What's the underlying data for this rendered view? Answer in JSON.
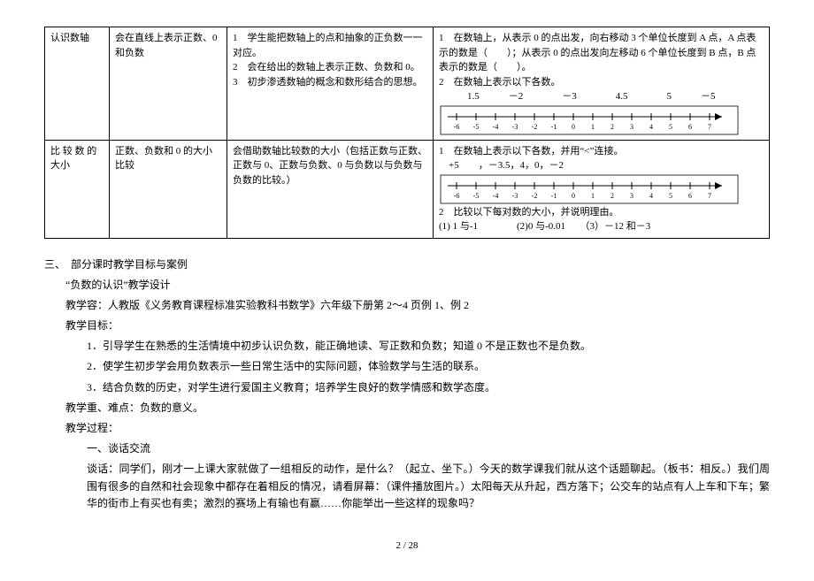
{
  "table": {
    "row1": {
      "c1": "认识数轴",
      "c2": "会在直线上表示正数、0 和负数",
      "c3_l1": "1　学生能把数轴上的点和抽象的正负数一一对应。",
      "c3_l2": "2　会在给出的数轴上表示正数、负数和 0。",
      "c3_l3": "3　初步渗透数轴的概念和数形结合的思想。",
      "c4_l1": "1　在数轴上，从表示 0 的点出发，向右移动 3 个单位长度到 A 点，A 点表示的数是（　　）；从表示 0 的点出发向左移动 6 个单位长度到 B 点，B 点表示的数是（　　）。",
      "c4_l2": "2　在数轴上表示以下各数。",
      "c4_nums": "　　1.5　　　－2　　　　－3　　　　4.5　　　　5　　　－5"
    },
    "row2": {
      "c1": "比 较 数 的大小",
      "c2": "正数、负数和 0 的大小比较",
      "c3": "会借助数轴比较数的大小（包括正数与正数、正数与 0、正数与负数、0 与负数以与负数与负数的比较。）",
      "c4_l1": "1　在数轴上表示以下各数，并用“<”连接。",
      "c4_nums": "　+5　　，－3.5，4，0，－2",
      "c4_l2": "2　比较以下每对数的大小，并说明理由。",
      "c4_l3": "(1) 1 与-1　　　　(2)0 与-0.01　　（3）－12 和－3"
    }
  },
  "section3": {
    "heading": "三、　部分课时教学目标与案例",
    "design_title": "“负数的认识”教学设计",
    "materials": "教学容：人教版《义务教育课程标准实验教科书数学》六年级下册第 2～4 页例 1、例 2",
    "goals_title": "教学目标：",
    "g1": "1．引导学生在熟悉的生活情境中初步认识负数，能正确地读、写正数和负数；知道 0 不是正数也不是负数。",
    "g2": "2．使学生初步学会用负数表示一些日常生活中的实际问题，体验数学与生活的联系。",
    "g3": "3．结合负数的历史，对学生进行爱国主义教育；培养学生良好的数学情感和数学态度。",
    "key": "教学重、难点：负数的意义。",
    "process": "教学过程：",
    "step1": "一、谈话交流",
    "talk1": "谈话：同学们，刚才一上课大家就做了一组相反的动作，是什么？（起立、坐下。）今天的数学课我们就从这个话题聊起。（板书：相反。）我们周围有很多的自然和社会现象中都存在着相反的情况，请看屏幕：（课件播放图片。）太阳每天从升起，西方落下；公交车的站点有人上车和下车；繁华的街市上有买也有卖；激烈的赛场上有输也有赢……你能举出一些这样的现象吗？"
  },
  "footer": "2  /  28"
}
